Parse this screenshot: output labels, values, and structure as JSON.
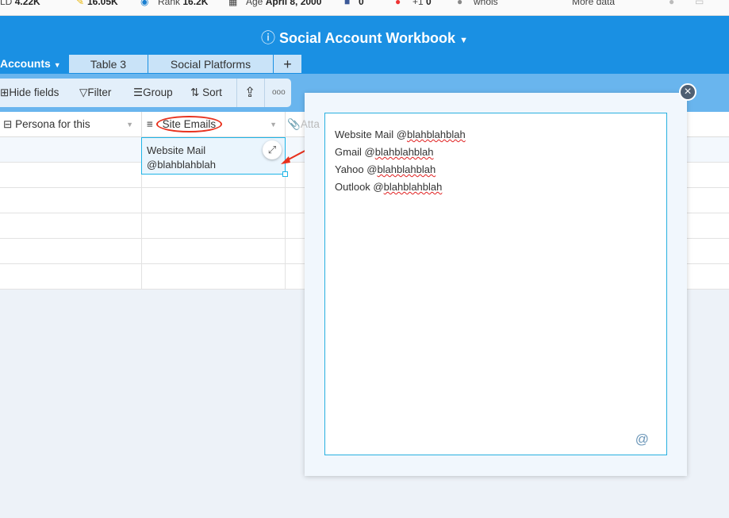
{
  "extension_bar": {
    "items": [
      {
        "label": "LD",
        "value": "4.22K"
      },
      {
        "label": "",
        "value": "16.05K"
      },
      {
        "label": "Rank",
        "value": "16.2K"
      },
      {
        "label": "Age",
        "value": "April 8, 2000"
      },
      {
        "label": "f",
        "value": "0"
      },
      {
        "label": "+1",
        "value": "0"
      },
      {
        "label": "whois",
        "value": ""
      },
      {
        "label": "More data",
        "value": ""
      }
    ]
  },
  "header": {
    "title": "Social Account Workbook"
  },
  "tabs": [
    {
      "label": "Accounts"
    },
    {
      "label": "Table 3"
    },
    {
      "label": "Social Platforms"
    },
    {
      "label": "+"
    }
  ],
  "toolbar": {
    "hide_fields": "Hide fields",
    "filter": "Filter",
    "group": "Group",
    "sort": "Sort"
  },
  "columns": [
    {
      "label": "Persona for this"
    },
    {
      "label": "Site Emails"
    },
    {
      "label": "Atta"
    }
  ],
  "cell": {
    "line1": "Website Mail",
    "line2": "@blahblahblah"
  },
  "expanded": {
    "lines": [
      {
        "prefix": "Website Mail @",
        "handle": "blahblahblah"
      },
      {
        "prefix": "Gmail @",
        "handle": "blahblahblah"
      },
      {
        "prefix": "Yahoo @",
        "handle": "blahblahblah"
      },
      {
        "prefix": "Outlook @",
        "handle": "blahblahblah"
      }
    ],
    "mention_icon": "@"
  },
  "colors": {
    "header_blue": "#1a90e3",
    "annotation_red": "#e8321e",
    "focus_cyan": "#1eb4e6"
  }
}
